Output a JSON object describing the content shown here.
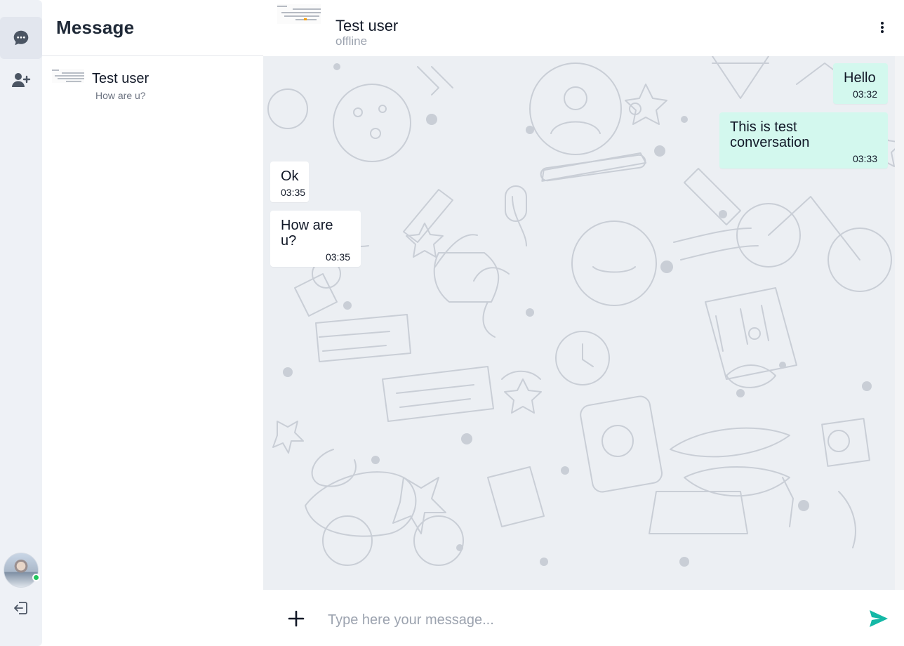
{
  "rail": {
    "items": [
      {
        "icon": "chat-bubble-icon",
        "active": true
      },
      {
        "icon": "add-user-icon",
        "active": false
      }
    ],
    "user_avatar": {
      "online": true,
      "status_color": "#22c55e"
    },
    "logout_icon": "logout-icon"
  },
  "sidebar": {
    "title": "Message",
    "conversations": [
      {
        "name": "Test user",
        "preview": "How are u?"
      }
    ]
  },
  "chat": {
    "contact_name": "Test user",
    "contact_status": "offline",
    "menu_icon": "more-vertical-icon",
    "messages": [
      {
        "direction": "outgoing",
        "text": "Hello",
        "time": "03:32"
      },
      {
        "direction": "outgoing",
        "text": "This is test conversation",
        "time": "03:33"
      },
      {
        "direction": "incoming",
        "text": "Ok",
        "time": "03:35"
      },
      {
        "direction": "incoming",
        "text": "How are u?",
        "time": "03:35"
      }
    ]
  },
  "composer": {
    "placeholder": "Type here your message...",
    "value": "",
    "attach_icon": "plus-icon",
    "send_icon": "send-icon"
  },
  "colors": {
    "accent": "#14b8a6",
    "outgoing_bubble": "#d3f8ee",
    "incoming_bubble": "#ffffff",
    "chat_background": "#eceff3",
    "rail_background": "#eef1f6"
  }
}
